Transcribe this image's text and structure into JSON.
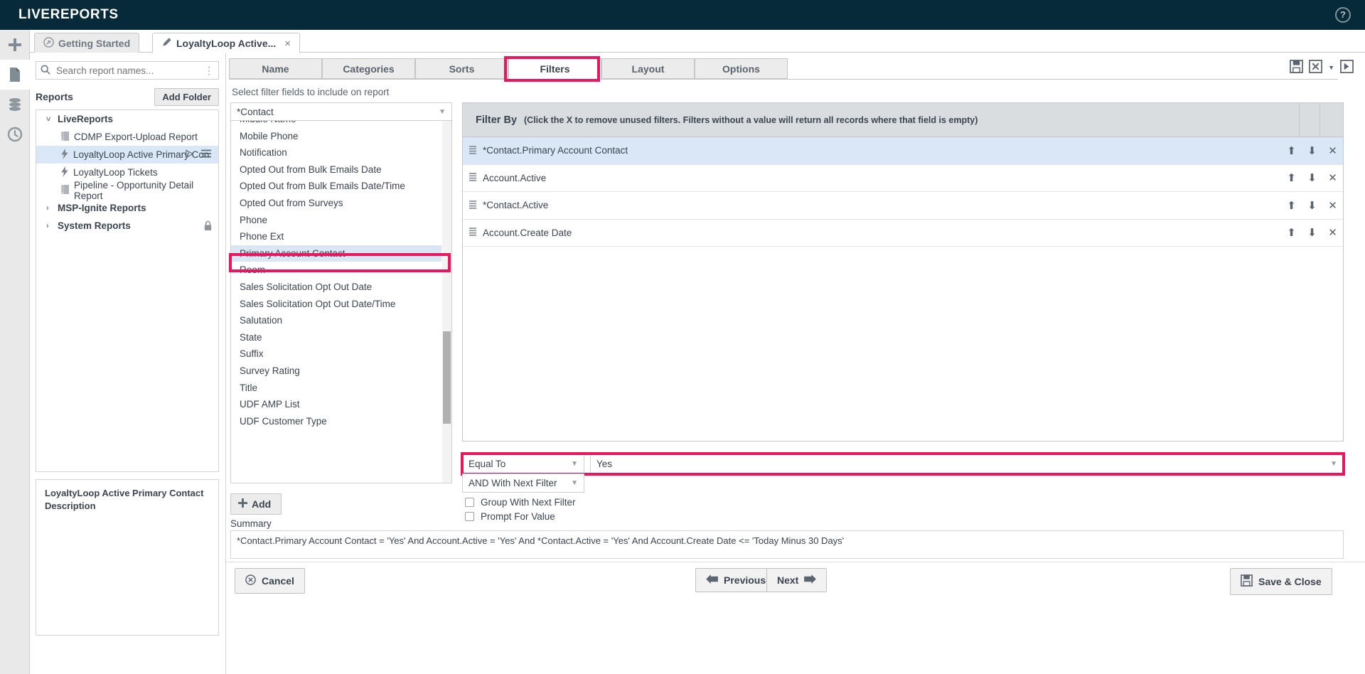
{
  "app": {
    "brand": "LIVEREPORTS",
    "help_icon": "help-icon",
    "accent_color": "#e8165f",
    "topbar_color": "#062a38"
  },
  "window_tabs": [
    {
      "label": "Getting Started",
      "icon": "compass-icon",
      "active": false,
      "closable": false
    },
    {
      "label": "LoyaltyLoop Active...",
      "icon": "pencil-icon",
      "active": true,
      "closable": true,
      "close_label": "×"
    }
  ],
  "rail": [
    {
      "name": "add-icon",
      "glyph": "plus"
    },
    {
      "name": "document-icon",
      "glyph": "page",
      "selected": true
    },
    {
      "name": "database-icon",
      "glyph": "stack"
    },
    {
      "name": "history-icon",
      "glyph": "clock"
    }
  ],
  "sidebar": {
    "search": {
      "placeholder": "Search report names...",
      "value": "",
      "icon": "search-icon",
      "menu_icon": "kebab-menu-icon"
    },
    "reports_label": "Reports",
    "add_folder_label": "Add Folder",
    "tree": [
      {
        "label": "LiveReports",
        "type": "folder",
        "expanded": true,
        "chevron": "˅",
        "depth": 0
      },
      {
        "label": "CDMP Export-Upload Report",
        "type": "report",
        "icon": "book-icon",
        "depth": 1
      },
      {
        "label": "LoyaltyLoop Active Primary Con",
        "type": "report",
        "icon": "bolt-icon",
        "depth": 1,
        "selected": true,
        "run_icon": "play-icon",
        "menu_icon": "hamburger-icon"
      },
      {
        "label": "LoyaltyLoop Tickets",
        "type": "report",
        "icon": "bolt-icon",
        "depth": 1
      },
      {
        "label": "Pipeline - Opportunity Detail Report",
        "type": "report",
        "icon": "book-icon",
        "depth": 1
      },
      {
        "label": "MSP-Ignite Reports",
        "type": "folder",
        "expanded": false,
        "chevron": "›",
        "depth": 0
      },
      {
        "label": "System Reports",
        "type": "folder",
        "expanded": false,
        "chevron": "›",
        "depth": 0,
        "locked": true,
        "lock_icon": "lock-icon"
      }
    ],
    "description": "LoyaltyLoop Active Primary Contact Description"
  },
  "wizard": {
    "tabs": [
      {
        "label": "Name",
        "active": false
      },
      {
        "label": "Categories",
        "active": false
      },
      {
        "label": "Sorts",
        "active": false
      },
      {
        "label": "Filters",
        "active": true,
        "highlighted": true
      },
      {
        "label": "Layout",
        "active": false
      },
      {
        "label": "Options",
        "active": false
      }
    ],
    "toolbar": [
      {
        "name": "save-disk-icon"
      },
      {
        "name": "excel-export-icon"
      },
      {
        "name": "dropdown-caret-icon"
      },
      {
        "name": "run-report-icon"
      }
    ],
    "hint": "Select filter fields to include on report",
    "field_source": {
      "value": "*Contact",
      "caret": "▼"
    },
    "field_list": [
      {
        "label": "Middle Name",
        "partial": true
      },
      {
        "label": "Mobile Phone"
      },
      {
        "label": "Notification"
      },
      {
        "label": "Opted Out from Bulk Emails Date"
      },
      {
        "label": "Opted Out from Bulk Emails Date/Time"
      },
      {
        "label": "Opted Out from Surveys"
      },
      {
        "label": "Phone"
      },
      {
        "label": "Phone Ext"
      },
      {
        "label": "Primary Account Contact",
        "selected": true,
        "highlighted": true
      },
      {
        "label": "Room"
      },
      {
        "label": "Sales Solicitation Opt Out Date"
      },
      {
        "label": "Sales Solicitation Opt Out Date/Time"
      },
      {
        "label": "Salutation"
      },
      {
        "label": "State"
      },
      {
        "label": "Suffix"
      },
      {
        "label": "Survey Rating"
      },
      {
        "label": "Title"
      },
      {
        "label": "UDF AMP List"
      },
      {
        "label": "UDF Customer Type",
        "partial": true
      }
    ],
    "add_button": {
      "label": "Add",
      "icon": "plus-icon"
    },
    "filter_table": {
      "header_title": "Filter By",
      "header_note": "(Click the X to remove unused filters. Filters without a value will return all records where that field is empty)",
      "rows": [
        {
          "field": "*Contact.Primary Account Contact",
          "selected": true,
          "up": "⬆",
          "down": "⬇",
          "remove": "✕"
        },
        {
          "field": "Account.Active",
          "selected": false,
          "up": "⬆",
          "down": "⬇",
          "remove": "✕"
        },
        {
          "field": "*Contact.Active",
          "selected": false,
          "up": "⬆",
          "down": "⬇",
          "remove": "✕"
        },
        {
          "field": "Account.Create Date",
          "selected": false,
          "up": "⬆",
          "down": "⬇",
          "remove": "✕"
        }
      ],
      "grip_icon": "drag-handle-icon"
    },
    "condition": {
      "operator": "Equal To",
      "value": "Yes",
      "join": "AND With Next Filter",
      "highlighted": true,
      "checkboxes": [
        {
          "label": "Group With Next Filter",
          "checked": false
        },
        {
          "label": "Prompt For Value",
          "checked": false
        }
      ]
    },
    "summary_label": "Summary",
    "summary_text": "*Contact.Primary Account Contact = 'Yes' And Account.Active = 'Yes' And *Contact.Active = 'Yes' And Account.Create Date <= 'Today Minus 30 Days'",
    "buttons": {
      "cancel": {
        "label": "Cancel",
        "icon": "cancel-icon"
      },
      "previous": {
        "label": "Previous",
        "icon": "arrow-left-icon"
      },
      "next": {
        "label": "Next",
        "icon": "arrow-right-icon"
      },
      "save_close": {
        "label": "Save & Close",
        "icon": "save-icon"
      }
    }
  }
}
